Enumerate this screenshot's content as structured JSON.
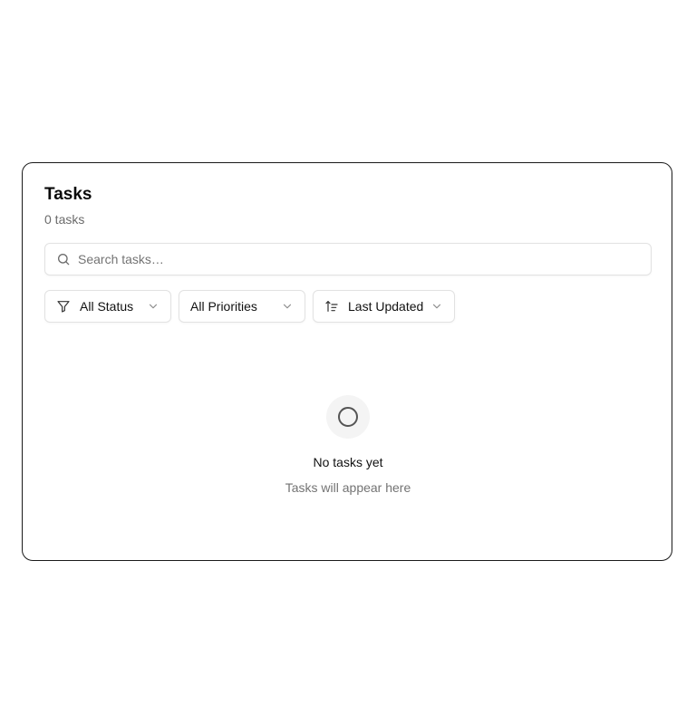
{
  "header": {
    "title": "Tasks",
    "count": "0 tasks"
  },
  "search": {
    "placeholder": "Search tasks…",
    "value": "",
    "icon": "search-icon"
  },
  "filters": {
    "status": {
      "label": "All Status",
      "icon": "filter-icon"
    },
    "priority": {
      "label": "All Priorities"
    },
    "sort": {
      "label": "Last Updated",
      "icon": "sort-ascending-icon"
    }
  },
  "empty_state": {
    "icon": "circle-icon",
    "title": "No tasks yet",
    "subtitle": "Tasks will appear here"
  },
  "colors": {
    "border": "#e2e2e2",
    "muted_text": "#737373",
    "icon_bg": "#f4f4f4"
  }
}
